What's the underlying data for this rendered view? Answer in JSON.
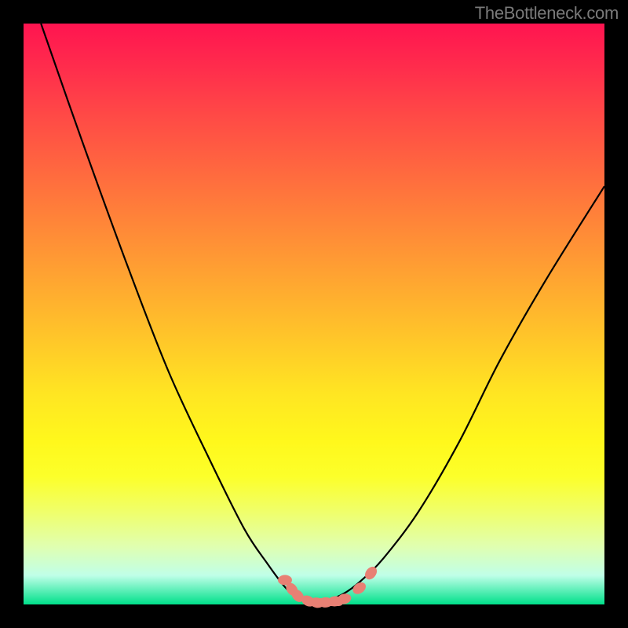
{
  "watermark": "TheBottleneck.com",
  "chart_data": {
    "type": "line",
    "title": "",
    "xlabel": "",
    "ylabel": "",
    "xlim": [
      0,
      100
    ],
    "ylim": [
      0,
      100
    ],
    "series": [
      {
        "name": "left-curve",
        "x": [
          3,
          10,
          18,
          25,
          32,
          38,
          42,
          45,
          47,
          49,
          50
        ],
        "values": [
          100,
          80,
          58,
          40,
          25,
          13,
          7,
          3,
          1.2,
          0.5,
          0.2
        ]
      },
      {
        "name": "right-curve",
        "x": [
          50,
          52,
          55,
          58,
          62,
          68,
          75,
          82,
          90,
          100
        ],
        "values": [
          0.2,
          0.6,
          1.8,
          4,
          8,
          16,
          28,
          42,
          56,
          72
        ]
      }
    ],
    "beads": {
      "name": "highlight-beads",
      "points": [
        {
          "x": 45.0,
          "y": 4.2
        },
        {
          "x": 46.2,
          "y": 2.6
        },
        {
          "x": 47.2,
          "y": 1.5
        },
        {
          "x": 49.0,
          "y": 0.6
        },
        {
          "x": 50.5,
          "y": 0.3
        },
        {
          "x": 52.0,
          "y": 0.35
        },
        {
          "x": 53.6,
          "y": 0.55
        },
        {
          "x": 55.2,
          "y": 0.95
        },
        {
          "x": 57.8,
          "y": 2.8
        },
        {
          "x": 59.8,
          "y": 5.4
        }
      ]
    },
    "gradient_bands": [
      "#ff1450",
      "#ff6440",
      "#ffb22e",
      "#fff81c",
      "#e0ffb0",
      "#00e08a"
    ]
  }
}
